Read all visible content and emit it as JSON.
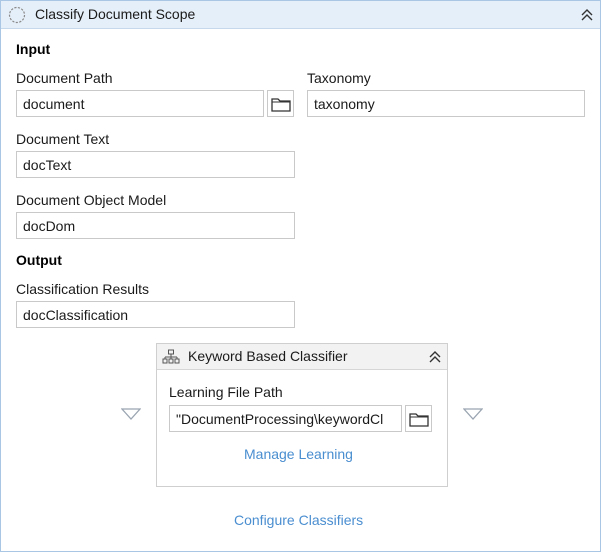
{
  "activity": {
    "title": "Classify Document Scope",
    "icon": "scope-circle-icon"
  },
  "input_section": {
    "title": "Input",
    "document_path": {
      "label": "Document Path",
      "value": "document"
    },
    "taxonomy": {
      "label": "Taxonomy",
      "value": "taxonomy"
    },
    "document_text": {
      "label": "Document Text",
      "value": "docText"
    },
    "document_object_model": {
      "label": "Document Object Model",
      "value": "docDom"
    }
  },
  "output_section": {
    "title": "Output",
    "classification_results": {
      "label": "Classification Results",
      "value": "docClassification"
    }
  },
  "classifier": {
    "title": "Keyword Based Classifier",
    "icon": "hierarchy-icon",
    "learning_file_path": {
      "label": "Learning File Path",
      "value": "\"DocumentProcessing\\keywordCl"
    },
    "manage_learning": "Manage Learning"
  },
  "configure_classifiers": "Configure Classifiers",
  "colors": {
    "header_bg": "#e5eff9",
    "border": "#a9c7e4",
    "link": "#4a8ed0"
  }
}
